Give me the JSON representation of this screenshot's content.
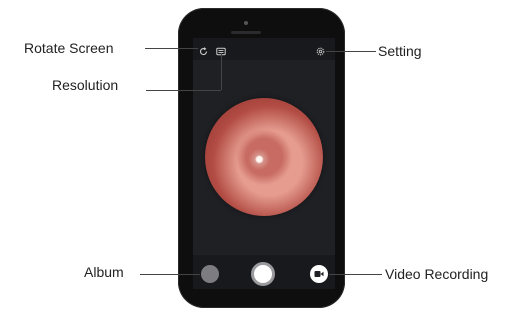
{
  "callouts": {
    "rotate_screen": "Rotate Screen",
    "resolution": "Resolution",
    "setting": "Setting",
    "album": "Album",
    "video_recording": "Video Recording"
  },
  "icons": {
    "rotate": "rotate-icon",
    "resolution": "resolution-icon",
    "setting": "gear-icon",
    "album": "album-icon",
    "shutter": "shutter-icon",
    "video": "video-camera-icon"
  },
  "colors": {
    "phone_body": "#0e0e0f",
    "screen_bg": "#1f2024",
    "ear_tone": "#c86c63"
  }
}
